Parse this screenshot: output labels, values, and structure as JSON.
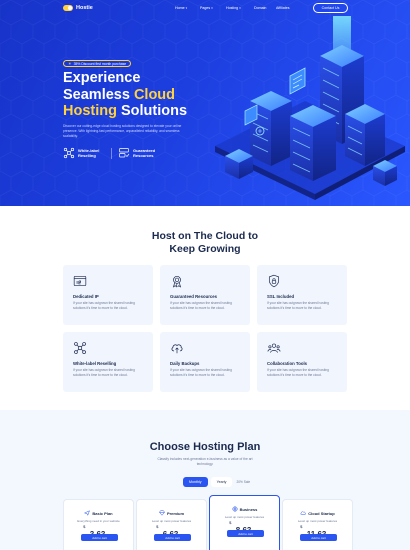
{
  "header": {
    "logo_text": "Hostie",
    "nav": [
      {
        "label": "Home",
        "has_dropdown": true
      },
      {
        "label": "Pages",
        "has_dropdown": true
      },
      {
        "label": "Hosting",
        "has_dropdown": true
      },
      {
        "label": "Domain",
        "has_dropdown": false
      },
      {
        "label": "Affiliates",
        "has_dropdown": false
      }
    ],
    "contact_label": "Contact Us"
  },
  "hero": {
    "promo": "35% Discount first month purchase",
    "title_line1": "Experience",
    "title_line2a": "Seamless ",
    "title_line2b": "Cloud",
    "title_line3a": "Hosting",
    "title_line3b": " Solutions",
    "description": "Discover our cutting-edge cloud hosting solutions designed to elevate your online presence. With lightning-fast performance, unparalleled reliability, and seamless scalability.",
    "features": [
      {
        "label": "White-label Reselling",
        "icon": "network-nodes-icon"
      },
      {
        "label": "Guaranteed Resources",
        "icon": "server-check-icon"
      }
    ],
    "colors": {
      "accent": "#ffd23f",
      "hero_bg": "#1d3fe0"
    }
  },
  "features_section": {
    "title_line1": "Host on The Cloud to",
    "title_line2": "Keep Growing",
    "cards": [
      {
        "title": "Dedicated IP",
        "description": "If your site has outgrown the shared hosting solutions it's time to move to the cloud.",
        "icon": "browser-ip-icon"
      },
      {
        "title": "Guaranteed Resources",
        "description": "If your site has outgrown the shared hosting solutions it's time to move to the cloud.",
        "icon": "medal-icon"
      },
      {
        "title": "SSL Included",
        "description": "If your site has outgrown the shared hosting solutions it's time to move to the cloud.",
        "icon": "shield-lock-icon"
      },
      {
        "title": "White-label Reselling",
        "description": "If your site has outgrown the shared hosting solutions it's time to move to the cloud.",
        "icon": "network-nodes-icon"
      },
      {
        "title": "Daily Backups",
        "description": "If your site has outgrown the shared hosting solutions it's time to move to the cloud.",
        "icon": "cloud-upload-icon"
      },
      {
        "title": "Collaboration Tools",
        "description": "If your site has outgrown the shared hosting solutions it's time to move to the cloud.",
        "icon": "team-icon"
      }
    ]
  },
  "pricing": {
    "title": "Choose Hosting Plan",
    "subtitle": "Classify includes next-generation e-business as a value of the art technology.",
    "toggle": {
      "monthly": "Monthly",
      "yearly": "Yearly",
      "save": "20% Sale"
    },
    "plans": [
      {
        "name": "Basic Plan",
        "desc": "Everything need in your website",
        "currency": "$",
        "price": "3.63",
        "period": "/month",
        "button": "Add to cart",
        "icon": "plane-icon"
      },
      {
        "name": "Premium",
        "desc": "Level up most power features",
        "currency": "$",
        "price": "6.63",
        "period": "/month",
        "button": "Add to cart",
        "icon": "diamond-icon"
      },
      {
        "name": "Business",
        "desc": "Level up most power features",
        "currency": "$",
        "price": "8.63",
        "period": "/month",
        "button": "Add to cart",
        "icon": "globe-icon"
      },
      {
        "name": "Cloud Startup",
        "desc": "Level up most power features",
        "currency": "$",
        "price": "11.63",
        "period": "/month",
        "button": "Add to cart",
        "icon": "cloud-icon"
      }
    ]
  }
}
